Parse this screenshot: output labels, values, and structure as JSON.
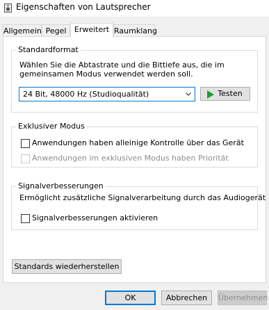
{
  "window": {
    "title": "Eigenschaften von Lautsprecher",
    "title_icon": "speaker-icon"
  },
  "tabs": [
    {
      "label": "Allgemein",
      "active": false
    },
    {
      "label": "Pegel",
      "active": false
    },
    {
      "label": "Erweitert",
      "active": true
    },
    {
      "label": "Raumklang",
      "active": false
    }
  ],
  "standard_format": {
    "legend": "Standardformat",
    "description_line1": "Wählen Sie die Abtastrate und die Bittiefe aus, die im",
    "description_line2": "gemeinsamen Modus verwendet werden soll.",
    "selected_format": "24 Bit, 48000 Hz (Studioqualität)",
    "test_button": "Testen"
  },
  "exclusive_mode": {
    "legend": "Exklusiver Modus",
    "option1": {
      "label": "Anwendungen haben alleinige Kontrolle über das Gerät",
      "checked": false,
      "enabled": true
    },
    "option2": {
      "label": "Anwendungen im exklusiven Modus haben Priorität",
      "checked": false,
      "enabled": false
    }
  },
  "signal_enhancements": {
    "legend": "Signalverbesserungen",
    "description": "Ermöglicht zusätzliche Signalverarbeitung durch das Audiogerät",
    "option": {
      "label": "Signalverbesserungen aktivieren",
      "checked": false
    }
  },
  "restore_defaults_button": "Standards wiederherstellen",
  "footer": {
    "ok": "OK",
    "cancel": "Abbrechen",
    "apply": "Übernehmen"
  },
  "colors": {
    "accent": "#0078d7",
    "play_green": "#1e9b37"
  }
}
